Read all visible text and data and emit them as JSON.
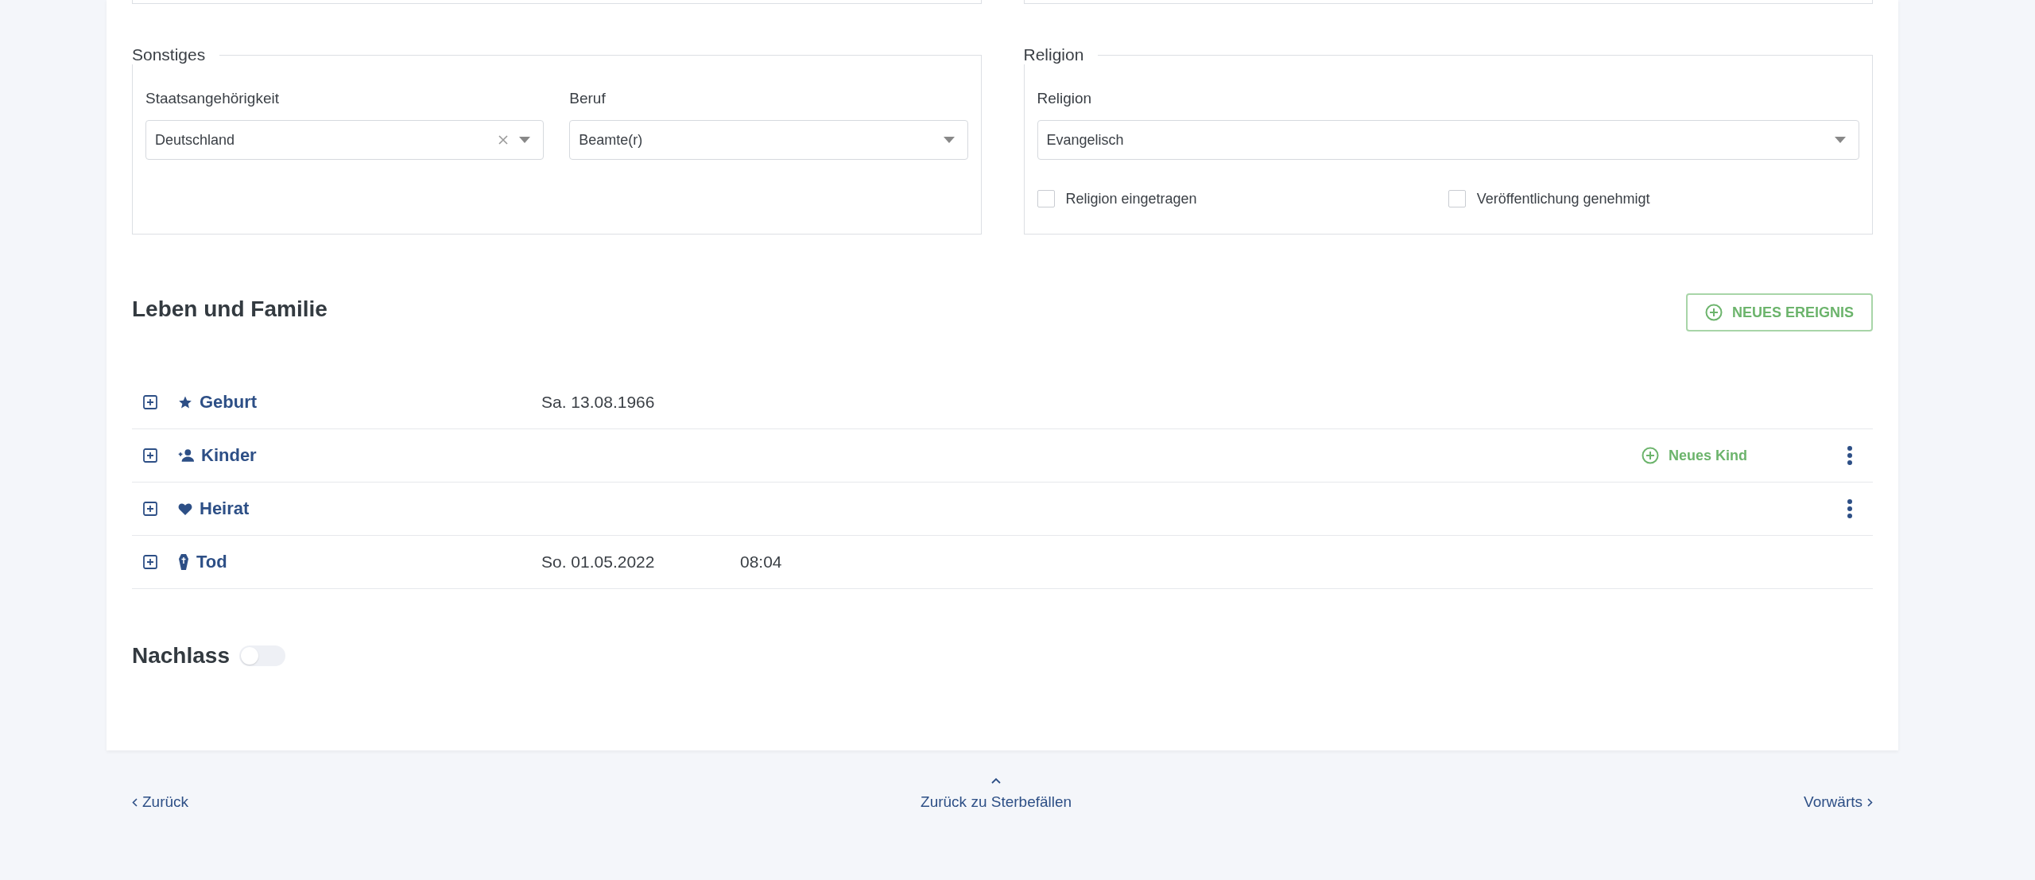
{
  "sections": [
    {
      "legend": "Sonstiges",
      "fields": [
        {
          "label": "Staatsangehörigkeit",
          "value": "Deutschland",
          "clearable": true
        },
        {
          "label": "Beruf",
          "value": "Beamte(r)",
          "clearable": false
        }
      ]
    },
    {
      "legend": "Religion",
      "fields": [
        {
          "label": "Religion",
          "value": "Evangelisch",
          "clearable": false
        }
      ],
      "checkboxes": [
        {
          "label": "Religion eingetragen",
          "checked": false
        },
        {
          "label": "Veröffentlichung genehmigt",
          "checked": false
        }
      ]
    }
  ],
  "events_section": {
    "title": "Leben und Familie",
    "add_button": "NEUES EREIGNIS",
    "events": [
      {
        "kind": "star",
        "name": "Geburt",
        "date": "Sa. 13.08.1966",
        "menu": false
      },
      {
        "kind": "person-add",
        "name": "Kinder",
        "action": "Neues Kind",
        "menu": true
      },
      {
        "kind": "heart",
        "name": "Heirat",
        "menu": true
      },
      {
        "kind": "coffin",
        "name": "Tod",
        "date": "So. 01.05.2022",
        "time": "08:04",
        "menu": false
      }
    ]
  },
  "estate": {
    "title": "Nachlass",
    "on": false
  },
  "footer": {
    "back": "Zurück",
    "up": "Zurück zu Sterbefällen",
    "forward": "Vorwärts"
  }
}
